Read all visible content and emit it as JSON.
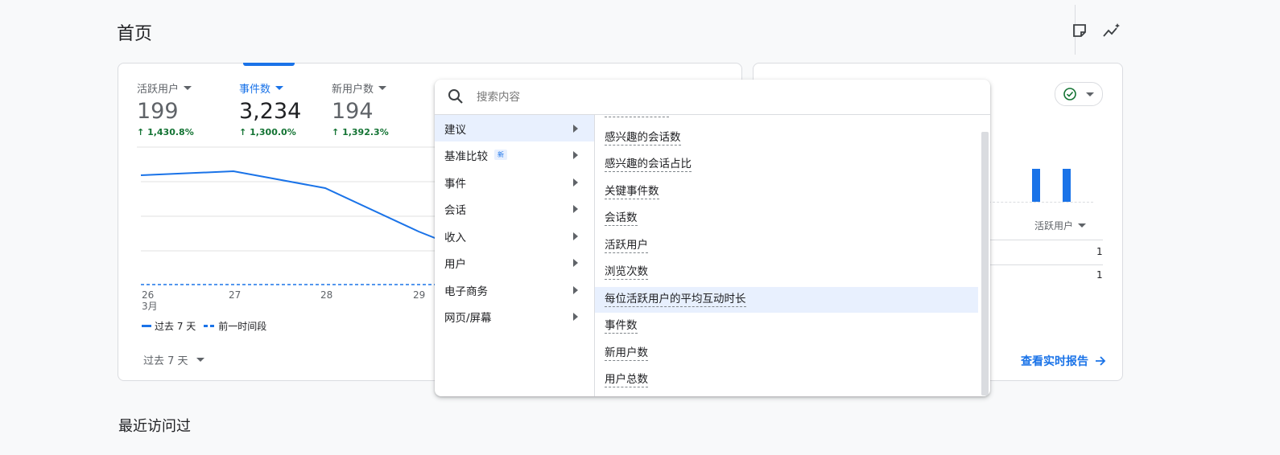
{
  "page": {
    "title": "首页",
    "recent_title": "最近访问过"
  },
  "metrics": [
    {
      "label": "活跃用户",
      "value": "199",
      "delta": "1,430.8%"
    },
    {
      "label": "事件数",
      "value": "3,234",
      "delta": "1,300.0%"
    },
    {
      "label": "新用户数",
      "value": "194",
      "delta": "1,392.3%"
    }
  ],
  "chart_data": {
    "type": "line",
    "categories": [
      "26\n3月",
      "27",
      "28",
      "29"
    ],
    "x_tick_labels": [
      "26",
      "27",
      "28",
      "29"
    ],
    "x_sub_label": "3月",
    "series": [
      {
        "name": "过去 7 天",
        "values": [
          null,
          null,
          null,
          null
        ]
      },
      {
        "name": "前一时间段",
        "values": [
          0,
          0,
          0,
          0
        ]
      }
    ]
  },
  "legend": {
    "current": "过去 7 天",
    "previous": "前一时间段"
  },
  "date_range": {
    "label": "过去 7 天"
  },
  "realtime": {
    "column_label": "活跃用户",
    "rows": [
      {
        "value": "1"
      },
      {
        "value": "1"
      }
    ],
    "link": "查看实时报告"
  },
  "dropdown": {
    "search_placeholder": "搜索内容",
    "categories": [
      {
        "label": "建议",
        "selected": true
      },
      {
        "label": "基准比较",
        "badge": "新"
      },
      {
        "label": "事件"
      },
      {
        "label": "会话"
      },
      {
        "label": "收入"
      },
      {
        "label": "用户"
      },
      {
        "label": "电子商务"
      },
      {
        "label": "网页/屏幕"
      }
    ],
    "options": [
      "感兴趣的会话数",
      "感兴趣的会话占比",
      "关键事件数",
      "会话数",
      "活跃用户",
      "浏览次数",
      "每位活跃用户的平均互动时长",
      "事件数",
      "新用户数",
      "用户总数"
    ],
    "highlighted_index": 6
  },
  "colors": {
    "accent": "#1a73e8",
    "positive": "#137333"
  }
}
